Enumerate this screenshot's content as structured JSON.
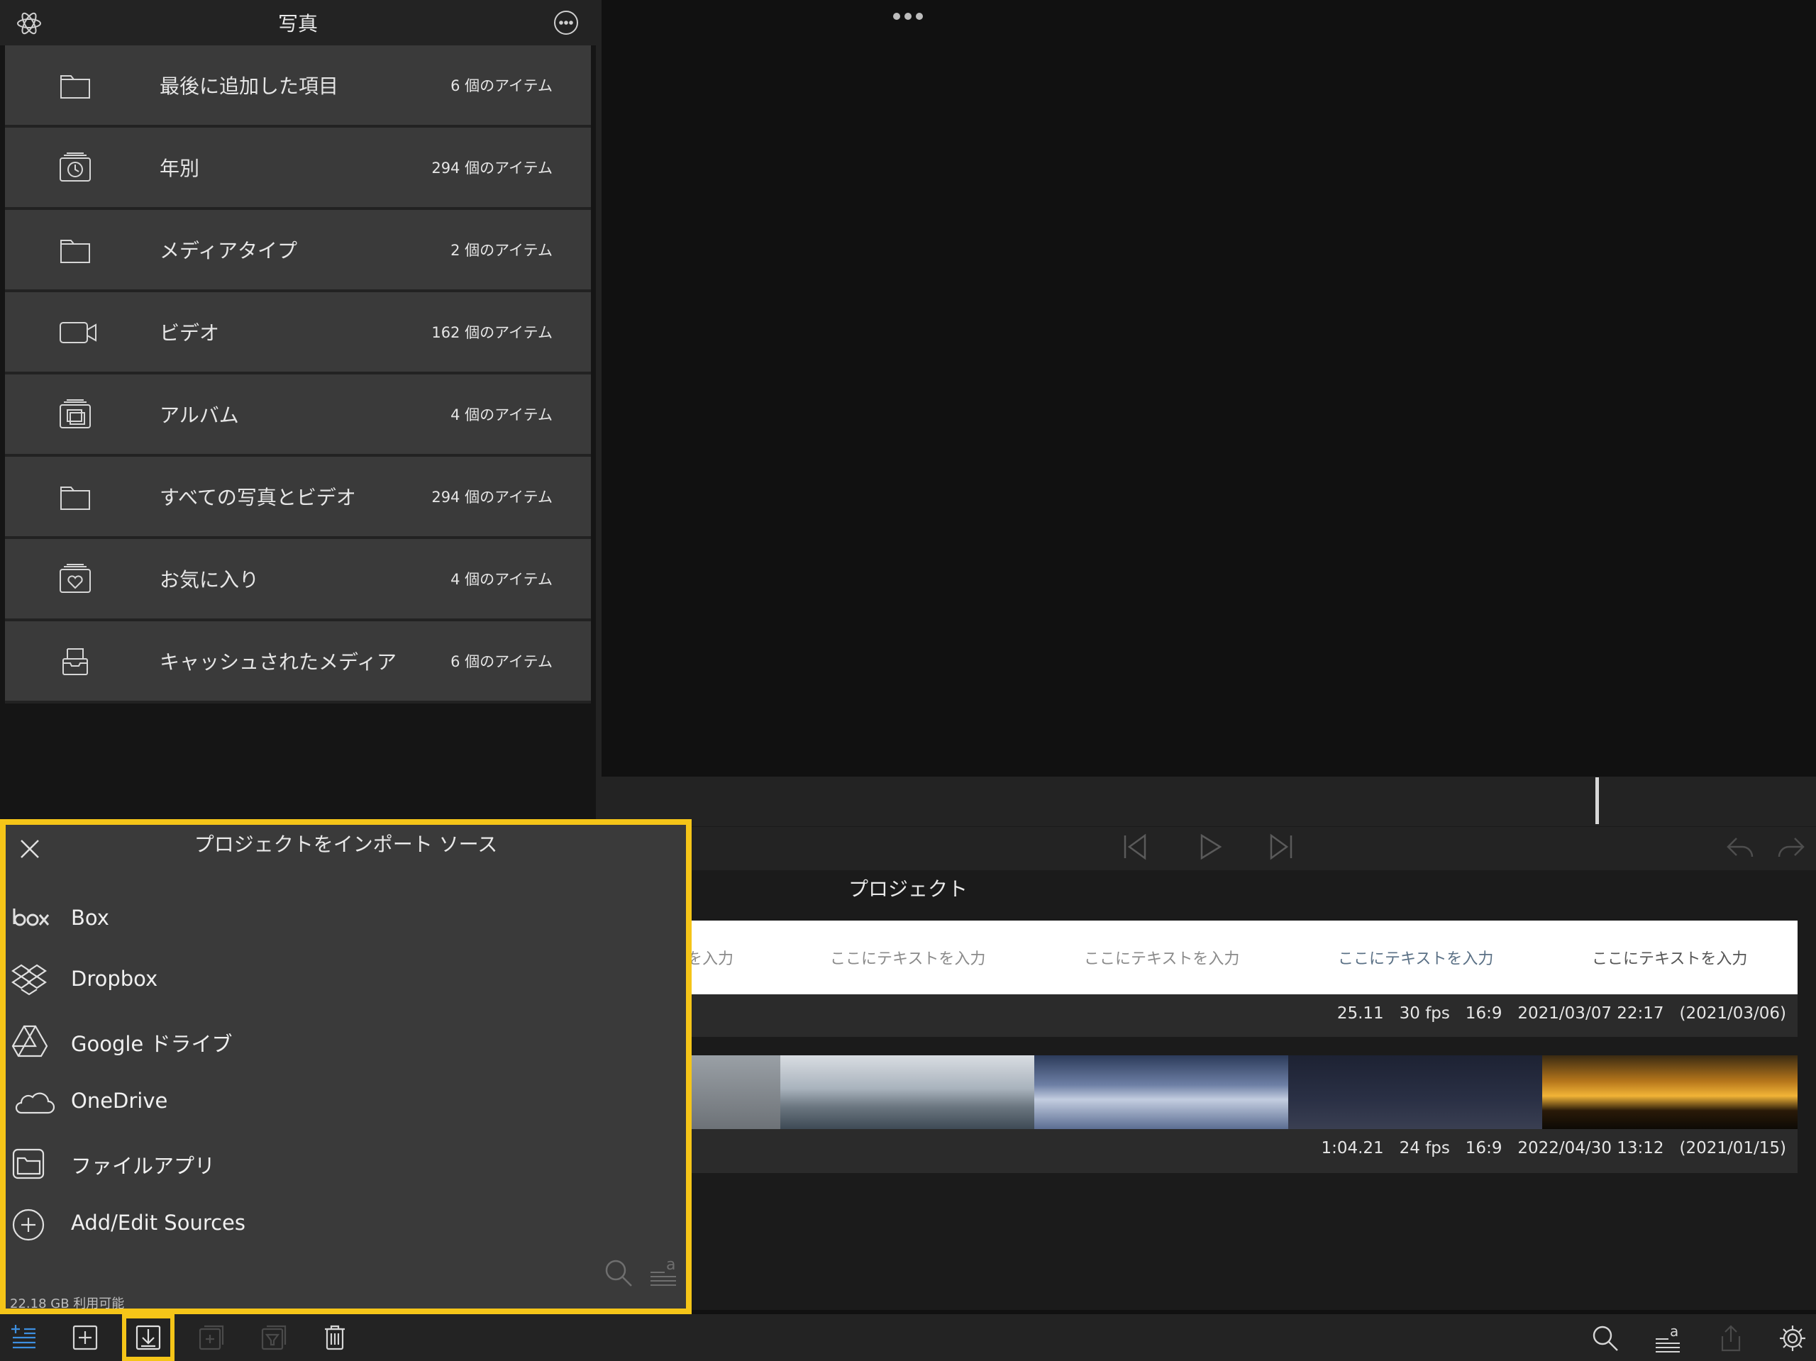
{
  "library": {
    "title": "写真",
    "items": [
      {
        "label": "最後に追加した項目",
        "count": "6 個のアイテム",
        "icon": "folder-icon"
      },
      {
        "label": "年別",
        "count": "294 個のアイテム",
        "icon": "clock-album-icon"
      },
      {
        "label": "メディアタイプ",
        "count": "2 個のアイテム",
        "icon": "folder-icon"
      },
      {
        "label": "ビデオ",
        "count": "162 個のアイテム",
        "icon": "video-camera-icon"
      },
      {
        "label": "アルバム",
        "count": "4 個のアイテム",
        "icon": "photo-album-icon"
      },
      {
        "label": "すべての写真とビデオ",
        "count": "294 個のアイテム",
        "icon": "folder-icon"
      },
      {
        "label": "お気に入り",
        "count": "4 個のアイテム",
        "icon": "heart-album-icon"
      },
      {
        "label": "キャッシュされたメディア",
        "count": "6 個のアイテム",
        "icon": "inbox-icon"
      }
    ]
  },
  "project": {
    "title": "プロジェクト",
    "text_cells": [
      "を入力",
      "ここにテキストを入力",
      "ここにテキストを入力",
      "ここにテキストを入力",
      "ここにテキストを入力"
    ],
    "clip1_info": "25.11   30 fps   16:9   2021/03/07 22:17   (2021/03/06)",
    "clip2_info": "1:04.21   24 fps   16:9   2022/04/30 13:12   (2021/01/15)"
  },
  "import_panel": {
    "title": "プロジェクトをインポート ソース",
    "sources": [
      {
        "label": "Box",
        "icon": "box-logo-icon"
      },
      {
        "label": "Dropbox",
        "icon": "dropbox-icon"
      },
      {
        "label": "Google ドライブ",
        "icon": "google-drive-icon"
      },
      {
        "label": "OneDrive",
        "icon": "cloud-icon"
      },
      {
        "label": "ファイルアプリ",
        "icon": "files-folder-icon"
      },
      {
        "label": "Add/Edit Sources",
        "icon": "plus-circle-icon"
      }
    ],
    "storage": "22.18 GB 利用可能"
  },
  "colors": {
    "highlight": "#f5c518",
    "accent": "#3d8fe0",
    "panel": "#3a3a3a"
  }
}
